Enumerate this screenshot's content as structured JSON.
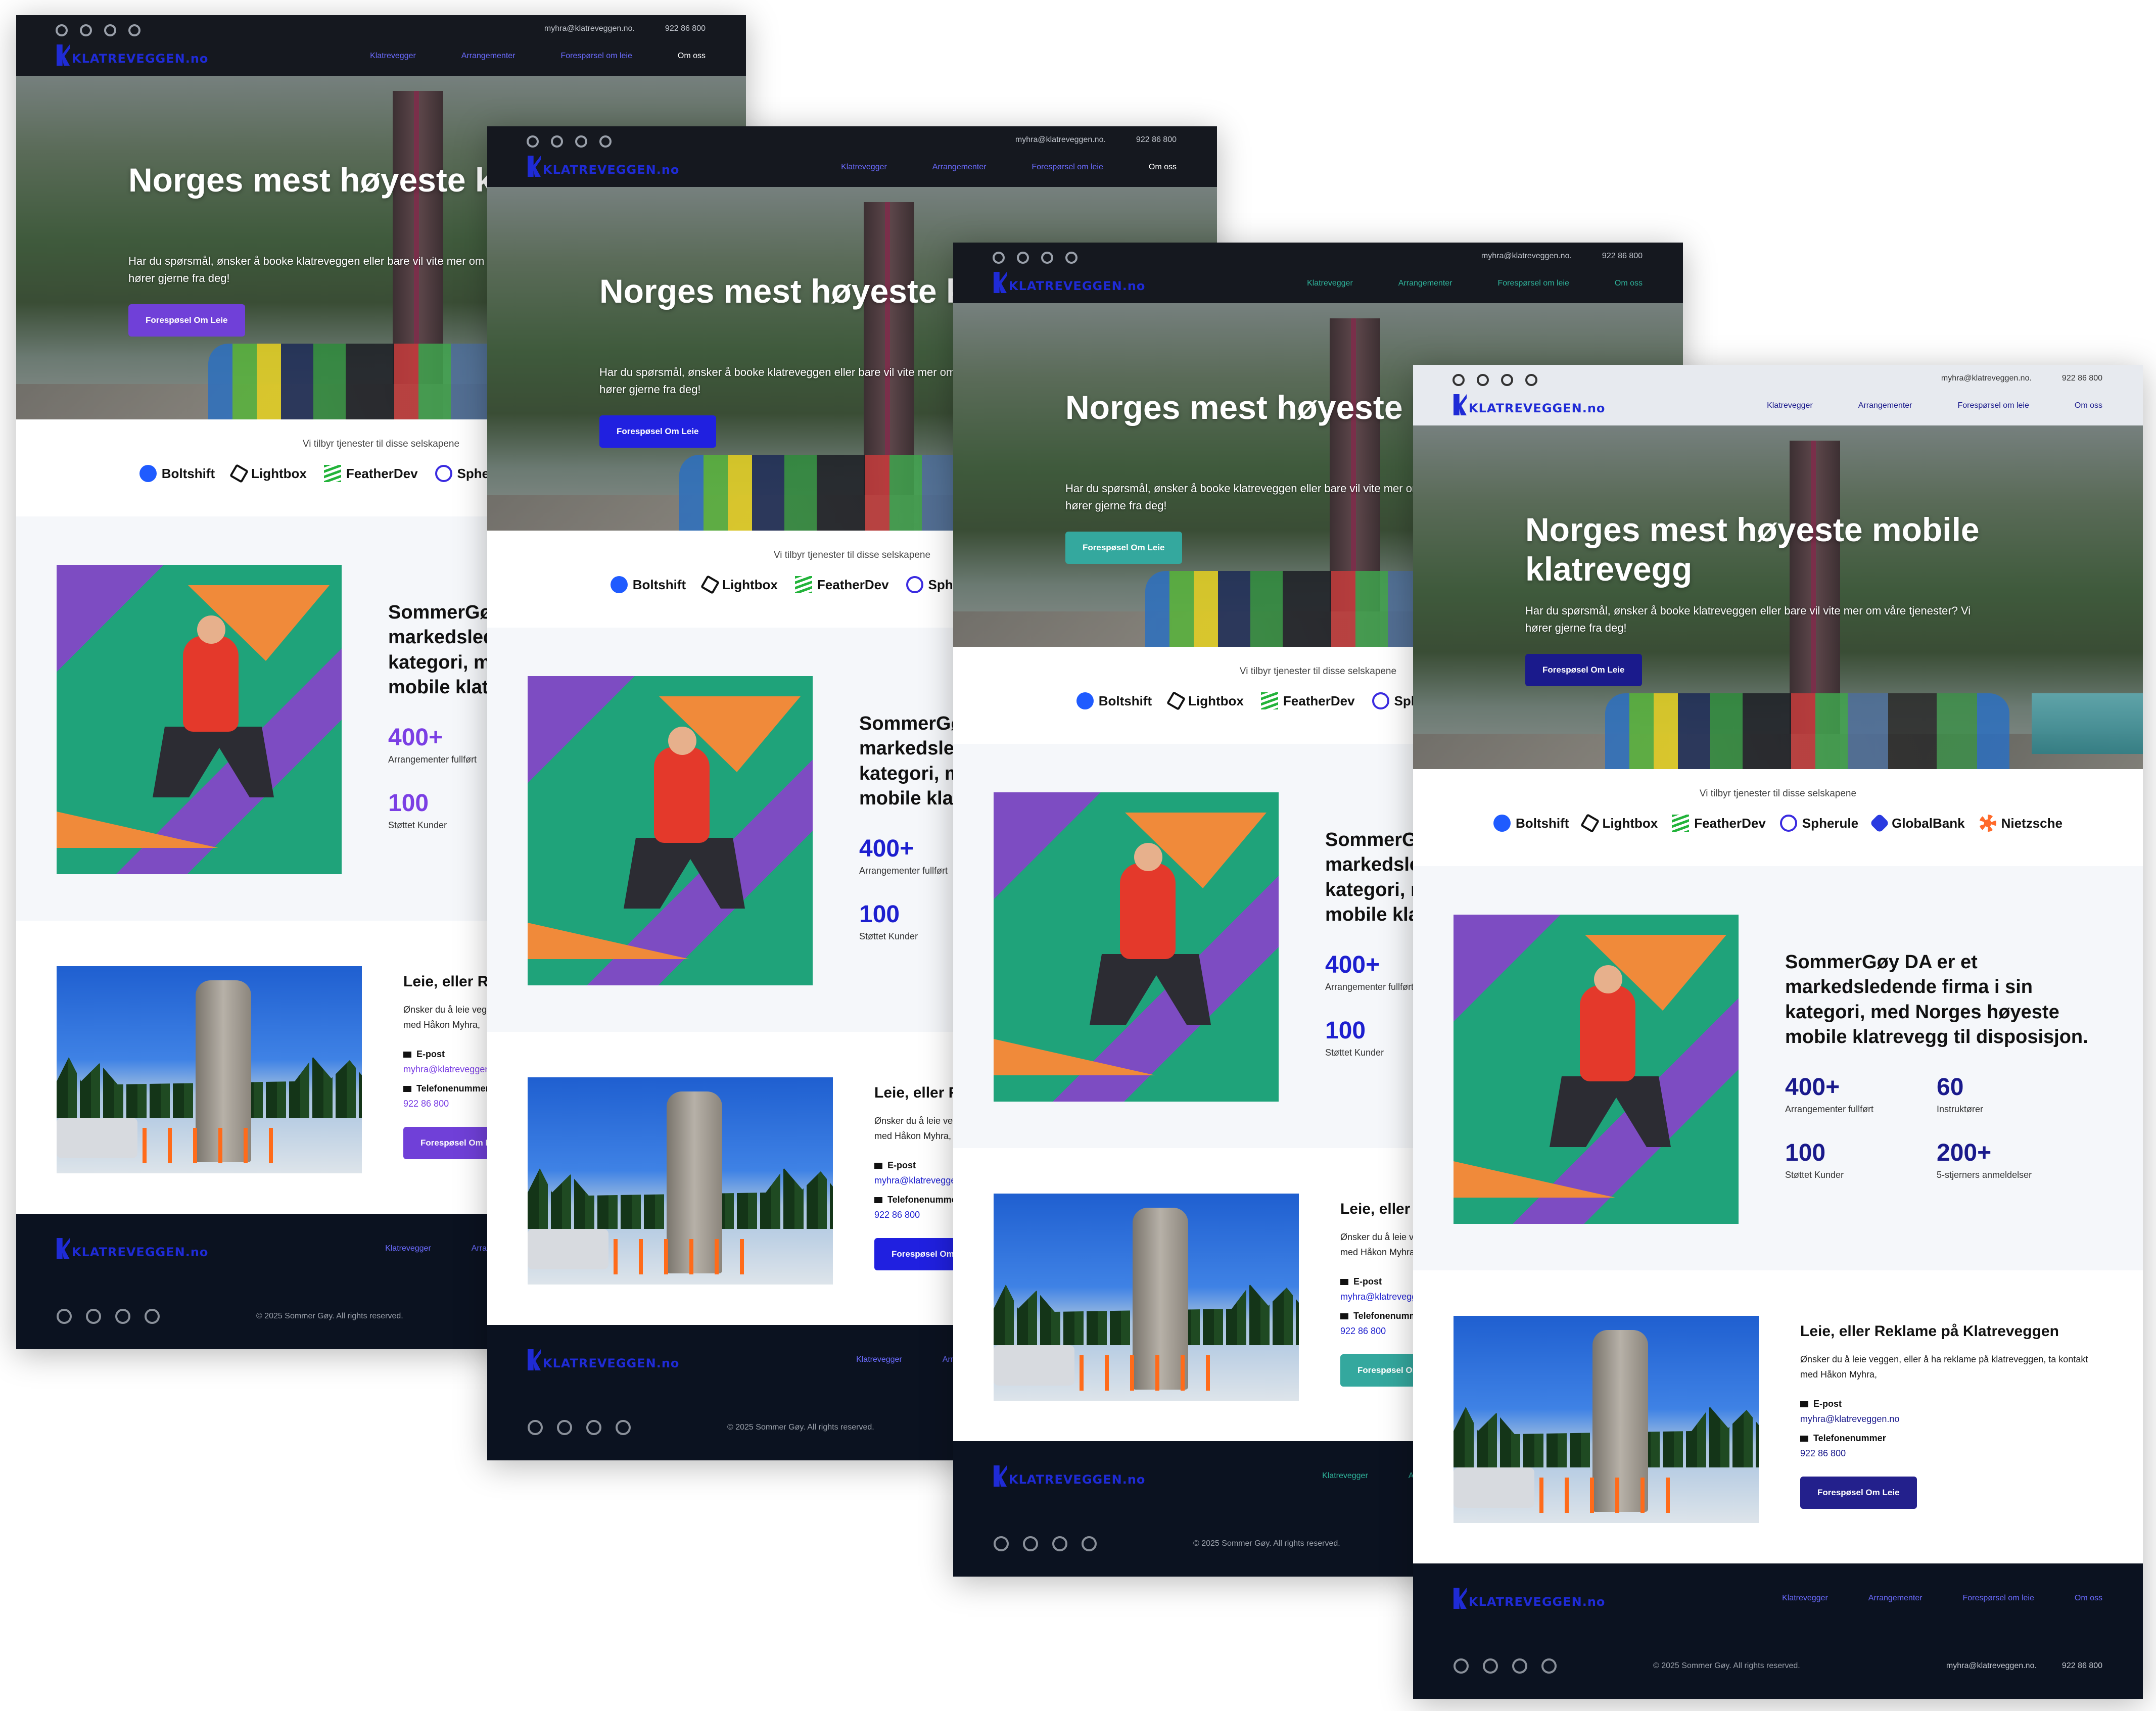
{
  "header": {
    "email": "myhra@klatreveggen.no.",
    "phone": "922 86 800",
    "logo_text": "KLATREVEGGEN.no",
    "nav": [
      "Klatrevegger",
      "Arrangementer",
      "Forespørsel om leie",
      "Om oss"
    ]
  },
  "hero": {
    "title_short": "Norges mest høyeste klatrevegg",
    "title_full": "Norges mest høyeste mobile klatrevegg",
    "text": "Har du spørsmål, ønsker å booke klatreveggen eller bare vil vite mer om våre tjenester? Vi hører gjerne fra deg!",
    "button": "Forespøsel Om Leie"
  },
  "clients": {
    "lead": "Vi tilbyr tjenester til disse selskapene",
    "brands": [
      "Boltshift",
      "Lightbox",
      "FeatherDev",
      "Spherule",
      "GlobalBank",
      "Nietzsche"
    ]
  },
  "about": {
    "text": "SommerGøy DA er et markedsledende firma i sin kategori, med Norges høyeste mobile klatrevegg til disposisjon.",
    "stats": [
      {
        "num": "400+",
        "label": "Arrangementer fullført"
      },
      {
        "num": "60",
        "label": "Instruktører"
      },
      {
        "num": "100",
        "label": "Støttet Kunder"
      },
      {
        "num": "200+",
        "label": "5-stjerners anmeldelser"
      }
    ]
  },
  "rent": {
    "title": "Leie, eller Reklame på Klatreveggen",
    "desc": "Ønsker du å leie veggen, eller å ha reklame på klatreveggen, ta kontakt med Håkon Myhra,",
    "email_label": "E-post",
    "email": "myhra@klatreveggen.no",
    "phone_label": "Telefonenummer",
    "phone": "922 86 800",
    "button": "Forespøsel Om Leie"
  },
  "footer": {
    "copyright": "© 2025 Sommer Gøy. All rights reserved.",
    "email": "myhra@klatreveggen.no.",
    "phone": "922 86 800"
  },
  "variants": [
    {
      "accent": "#7b3fe4",
      "button": "#7040d8"
    },
    {
      "accent": "#1d1fcf",
      "button": "#2020e0"
    },
    {
      "accent": "#2f9e96",
      "button": "#34a89e"
    },
    {
      "accent": "#1a1a8c",
      "button": "#23208c"
    }
  ]
}
